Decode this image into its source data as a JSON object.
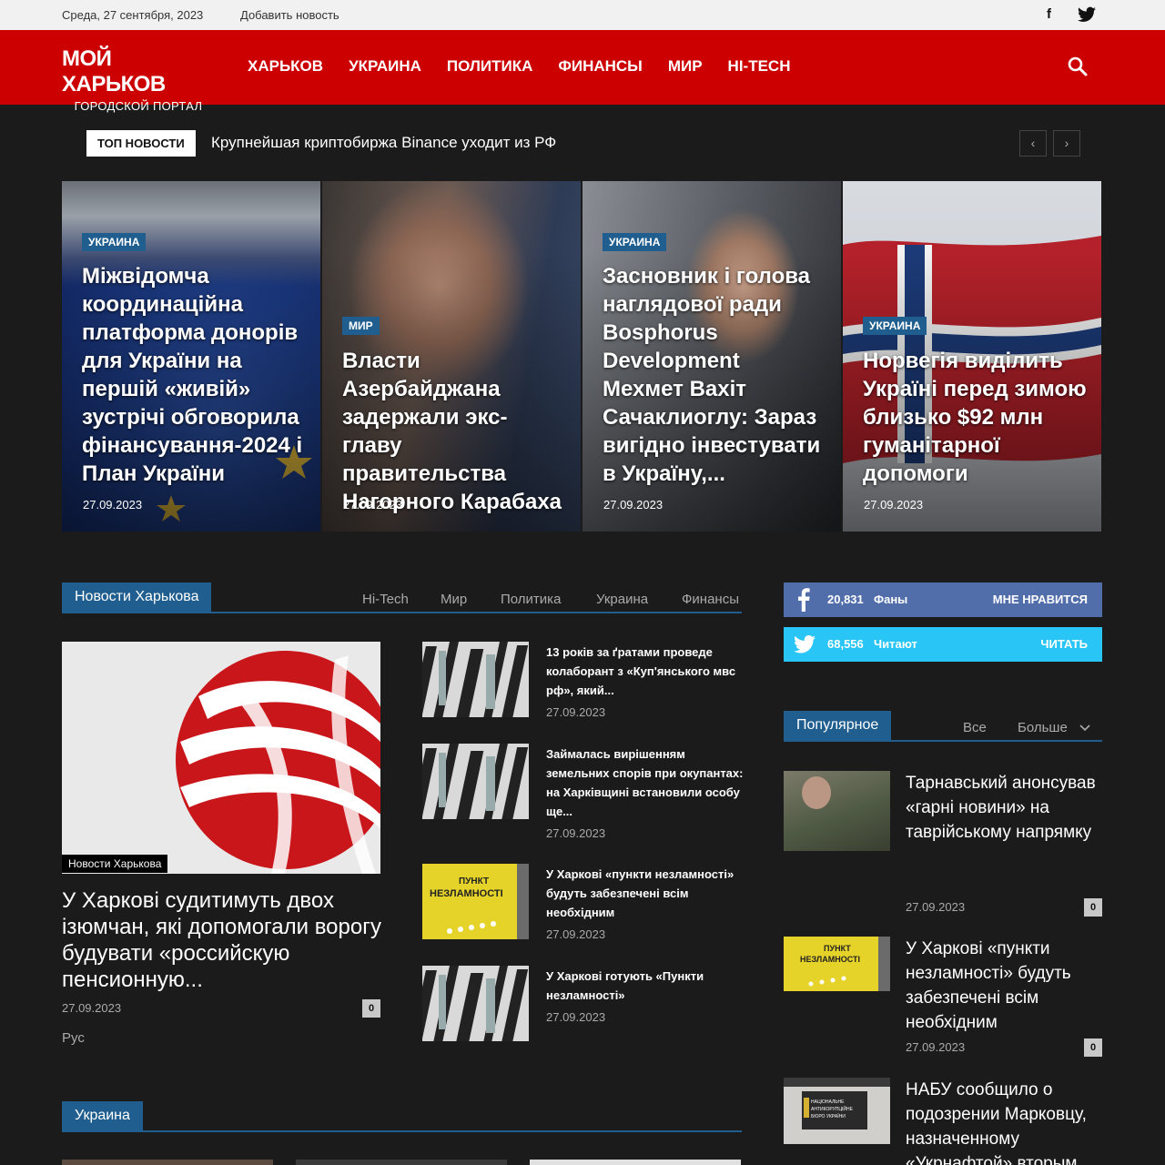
{
  "topbar": {
    "date": "Среда, 27 сентября, 2023",
    "add_news": "Добавить новость",
    "facebook_glyph": "f"
  },
  "logo": {
    "line1": "МОЙ ХАРЬКОВ",
    "line2": "ГОРОДСКОЙ ПОРТАЛ"
  },
  "nav": [
    "ХАРЬКОВ",
    "УКРАИНА",
    "ПОЛИТИКА",
    "ФИНАНСЫ",
    "МИР",
    "HI-TECH"
  ],
  "ticker": {
    "tag": "ТОП НОВОСТИ",
    "headline": "Крупнейшая криптобиржа Binance уходит из РФ",
    "prev": "‹",
    "next": "›"
  },
  "features": [
    {
      "category": "УКРАИНА",
      "title": "Міжвідомча координаційна платформа донорів для України на першій «живій» зустрічі обговорила фінансування-2024 і План України",
      "date": "27.09.2023"
    },
    {
      "category": "МИР",
      "title": "Власти Азербайджана задержали экс-главу правительства Нагорного Карабаха",
      "date": "27.09.2023"
    },
    {
      "category": "УКРАИНА",
      "title": "Засновник і голова наглядової ради Bosphorus Development Мехмет Вахіт Сачаклиоглу: Зараз вигідно інвестувати в Україну,...",
      "date": "27.09.2023"
    },
    {
      "category": "УКРАИНА",
      "title": "Норвегія виділить Україні перед зимою близько $92 млн гуманітарної допомоги",
      "date": "27.09.2023"
    }
  ],
  "kharkiv_block": {
    "title": "Новости Харькова",
    "filters": [
      "Hi-Tech",
      "Мир",
      "Политика",
      "Украина",
      "Финансы"
    ],
    "main": {
      "category": "Новости Харькова",
      "title": "У Харкові судитимуть двох ізюмчан, які допомогали ворогу будувати «российскую пенсионную...",
      "date": "27.09.2023",
      "comments": "0",
      "lang": "Рус"
    },
    "items": [
      {
        "title": "13 років за ґратами проведе колаборант з «Куп'янського мвс рф», який...",
        "date": "27.09.2023"
      },
      {
        "title": "Займалась вирішенням земельних спорів при окупантах: на Харківщині встановили особу ще...",
        "date": "27.09.2023"
      },
      {
        "title": "У Харкові «пункти незламності» будуть забезпечені всім необхідним",
        "date": "27.09.2023"
      },
      {
        "title": "У Харкові готують «Пункти незламності»",
        "date": "27.09.2023"
      }
    ]
  },
  "thumb_text": {
    "punkt_line1": "ПУНКТ",
    "punkt_line2": "НЕЗЛАМНОСТІ",
    "nabu_line1": "НАЦІОНАЛЬНЕ",
    "nabu_line2": "АНТИКОРУПЦІЙНЕ",
    "nabu_line3": "БЮРО УКРАЇНИ"
  },
  "social": {
    "facebook": {
      "count": "20,831",
      "label": "Фаны",
      "action": "МНЕ НРАВИТСЯ",
      "color": "#516eab"
    },
    "twitter": {
      "count": "68,556",
      "label": "Читают",
      "action": "ЧИТАТЬ",
      "color": "#29c5f6"
    }
  },
  "popular": {
    "title": "Популярное",
    "tab_all": "Все",
    "tab_more": "Больше",
    "items": [
      {
        "title": "Тарнавський анонсував «гарні новини» на таврійському напрямку",
        "date": "27.09.2023",
        "comments": "0"
      },
      {
        "title": "У Харкові «пункти незламності» будуть забезпечені всім необхідним",
        "date": "27.09.2023",
        "comments": "0"
      },
      {
        "title": "НАБУ сообщило о подозрении Марковцу, назначенному «Укрнафтой» вторым"
      }
    ]
  },
  "ukraine_block": {
    "title": "Украина"
  },
  "colors": {
    "brand_red": "#cc0000",
    "accent_blue": "#1f5e8e",
    "background": "#1b1b1b"
  }
}
